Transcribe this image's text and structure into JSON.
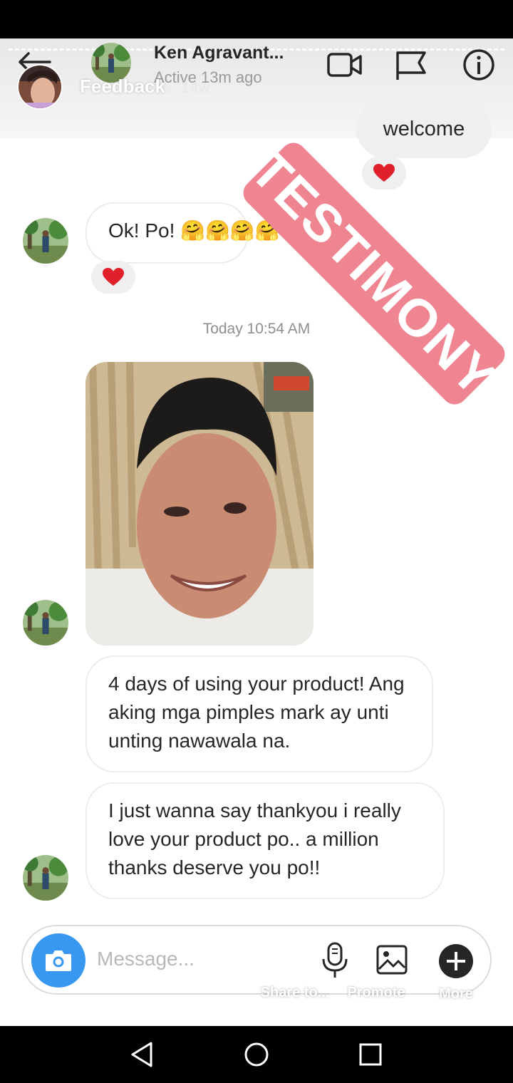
{
  "header": {
    "contact_name": "Ken Agravant...",
    "contact_status": "Active 13m ago",
    "icons": [
      "back-arrow-icon",
      "video-call-icon",
      "flag-icon",
      "info-icon"
    ]
  },
  "story": {
    "title": "Feedback",
    "age": "14w"
  },
  "messages": {
    "welcome": "welcome",
    "ok": "Ok! Po! 🤗🤗🤗🤗",
    "timestamp": "Today 10:54 AM",
    "testimony_1": "4 days of using your product! Ang aking mga pimples mark ay unti unting nawawala na.",
    "testimony_2": "I just wanna say thankyou i really love your product po.. a million thanks deserve you po!!"
  },
  "overlay": {
    "stamp_text": "TESTIMONY",
    "stamp_color": "#ef8591"
  },
  "composer": {
    "placeholder": "Message..."
  },
  "story_tools": {
    "share": "Share to...",
    "promote": "Promote",
    "more": "More"
  },
  "colors": {
    "accent_blue": "#3897f0",
    "heart_red": "#e0202a"
  }
}
